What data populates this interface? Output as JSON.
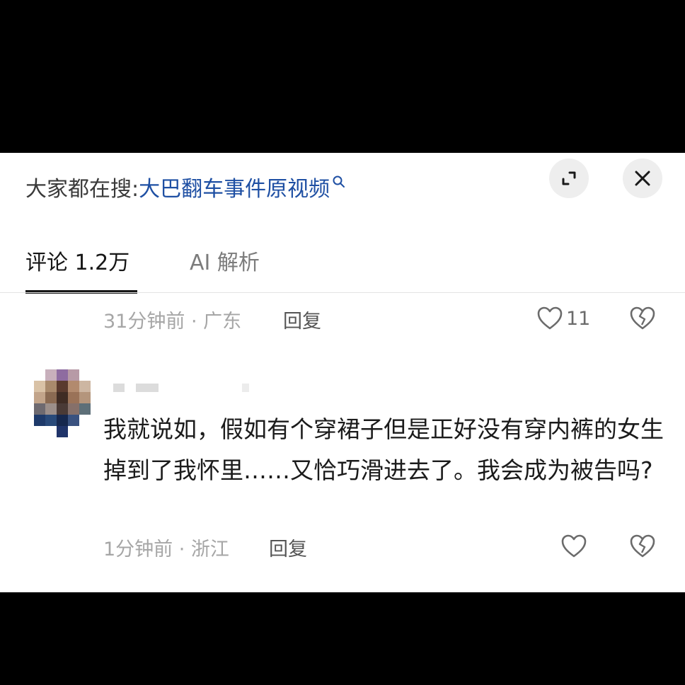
{
  "header": {
    "search_prefix": "大家都在搜:",
    "search_term": "大巴翻车事件原视频",
    "expand_icon": "expand-arrows-icon",
    "close_icon": "close-icon"
  },
  "tabs": [
    {
      "label": "评论 1.2万",
      "active": true
    },
    {
      "label": "AI 解析",
      "active": false
    }
  ],
  "comments": [
    {
      "time_location": "31分钟前 · 广东",
      "reply_label": "回复",
      "like_count": "11"
    },
    {
      "author": "",
      "text": "我就说如，假如有个穿裙子但是正好没有穿内裤的女生掉到了我怀里……又恰巧滑进去了。我会成为被告吗?",
      "time_location": "1分钟前 · 浙江",
      "reply_label": "回复",
      "like_count": ""
    }
  ],
  "colors": {
    "link": "#1e4fa3",
    "muted": "#a6a6a6",
    "text": "#1b1b1b",
    "background": "#000000"
  }
}
